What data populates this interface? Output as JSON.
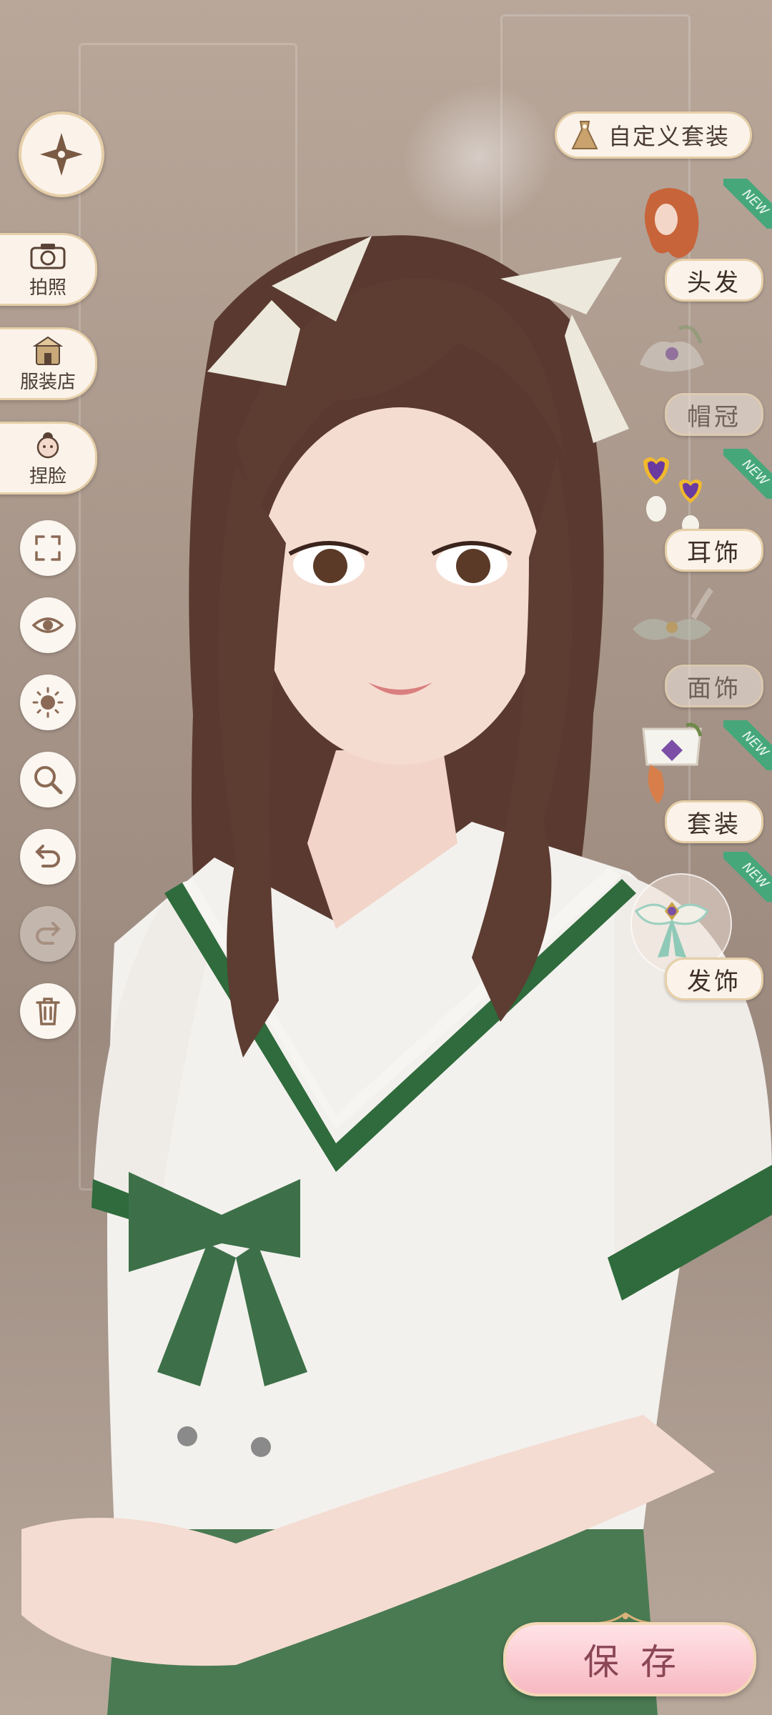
{
  "left_rail": {
    "items": [
      {
        "label": "拍照",
        "icon": "camera-icon"
      },
      {
        "label": "服装店",
        "icon": "shop-icon"
      },
      {
        "label": "捏脸",
        "icon": "face-icon"
      }
    ],
    "tools": [
      {
        "icon": "fullscreen-icon",
        "enabled": true
      },
      {
        "icon": "eye-icon",
        "enabled": true
      },
      {
        "icon": "lighting-icon",
        "enabled": true
      },
      {
        "icon": "zoom-icon",
        "enabled": true
      },
      {
        "icon": "undo-icon",
        "enabled": true
      },
      {
        "icon": "redo-icon",
        "enabled": false
      },
      {
        "icon": "trash-icon",
        "enabled": true
      }
    ]
  },
  "right_panel": {
    "custom_outfit_label": "自定义套装",
    "categories": [
      {
        "label": "头发",
        "new": true,
        "dim": false
      },
      {
        "label": "帽冠",
        "new": false,
        "dim": true
      },
      {
        "label": "耳饰",
        "new": true,
        "dim": false
      },
      {
        "label": "面饰",
        "new": false,
        "dim": true
      },
      {
        "label": "套装",
        "new": true,
        "dim": false
      },
      {
        "label": "发饰",
        "new": true,
        "dim": false,
        "selected": true
      }
    ],
    "new_badge_text": "NEW"
  },
  "save_label": "保存",
  "colors": {
    "panel_bg": "#fbf3ea",
    "panel_border": "#e6cfa8",
    "new_badge": "#46a77a",
    "save_pink": "#f7b9c2",
    "save_text": "#8b4656"
  }
}
